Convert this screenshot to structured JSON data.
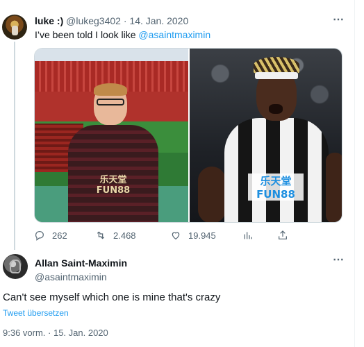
{
  "tweet": {
    "display_name": "luke :)",
    "handle": "@lukeg3402",
    "separator": "·",
    "date": "14. Jan. 2020",
    "text": "I’ve been told I look like ",
    "mention": "@asaintmaximin",
    "more_icon": "⋯",
    "media": {
      "left_sponsor": "乐天堂 FUN88",
      "right_sponsor": "乐天堂 FUN88"
    },
    "stats": {
      "replies": "262",
      "retweets": "2.468",
      "likes": "19.945"
    }
  },
  "reply": {
    "display_name": "Allan Saint-Maximin",
    "handle": "@asaintmaximin",
    "more_icon": "⋯",
    "text": "Can't see myself which one is mine that's crazy",
    "translate_label": "Tweet übersetzen",
    "timestamp": "9:36 vorm. · 15. Jan. 2020"
  },
  "colors": {
    "accent": "#1d9bf0",
    "muted": "#536471",
    "text": "#0f1419"
  }
}
